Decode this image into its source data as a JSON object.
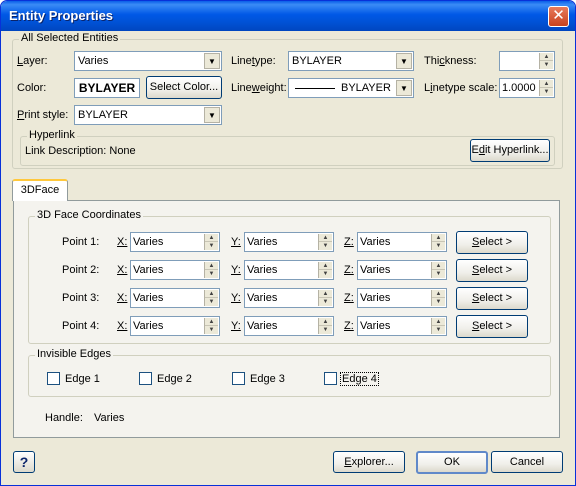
{
  "window": {
    "title": "Entity Properties",
    "close_glyph": "✕"
  },
  "all_selected": {
    "legend": "All Selected Entities",
    "layer": {
      "label_u": "L",
      "label_rest": "ayer:",
      "value": "Varies"
    },
    "linetype": {
      "label_pre": "Line",
      "label_u": "t",
      "label_rest": "ype:",
      "value": "BYLAYER"
    },
    "thickness": {
      "label_pre": "Thi",
      "label_u": "c",
      "label_rest": "kness:",
      "value": ""
    },
    "color": {
      "label": "Color:",
      "swatch_text": "BYLAYER",
      "button": "Select Color..."
    },
    "lineweight": {
      "label_pre": "Line",
      "label_u": "w",
      "label_rest": "eight:",
      "value": "BYLAYER"
    },
    "linetype_scale": {
      "label_pre": "L",
      "label_u": "i",
      "label_rest": "netype scale:",
      "value": "1.0000"
    },
    "print_style": {
      "label_u": "P",
      "label_rest": "rint style:",
      "value": "BYLAYER"
    },
    "hyperlink": {
      "legend": "Hyperlink",
      "description": "Link Description: None",
      "button_pre": "E",
      "button_u": "d",
      "button_rest": "it Hyperlink..."
    }
  },
  "tabs": [
    {
      "label": "3DFace"
    }
  ],
  "coords": {
    "legend": "3D Face Coordinates",
    "points": [
      {
        "label": "Point 1:",
        "x": "Varies",
        "y": "Varies",
        "z": "Varies"
      },
      {
        "label": "Point 2:",
        "x": "Varies",
        "y": "Varies",
        "z": "Varies"
      },
      {
        "label": "Point 3:",
        "x": "Varies",
        "y": "Varies",
        "z": "Varies"
      },
      {
        "label": "Point 4:",
        "x": "Varies",
        "y": "Varies",
        "z": "Varies"
      }
    ],
    "x_label": "X:",
    "y_label": "Y:",
    "z_label": "Z:",
    "select_u": "S",
    "select_rest": "elect >"
  },
  "invisible_edges": {
    "legend": "Invisible Edges",
    "edges": [
      {
        "label": "Edge 1",
        "checked": false
      },
      {
        "label": "Edge 2",
        "checked": false
      },
      {
        "label": "Edge 3",
        "checked": false
      },
      {
        "label": "Edge 4",
        "checked": false
      }
    ]
  },
  "handle": {
    "label": "Handle:",
    "value": "Varies"
  },
  "footer": {
    "help": "?",
    "explorer_u": "E",
    "explorer_rest": "xplorer...",
    "ok": "OK",
    "cancel": "Cancel"
  },
  "icons": {
    "combo_arrow": "▼",
    "spin_up": "▲",
    "spin_down": "▼"
  }
}
